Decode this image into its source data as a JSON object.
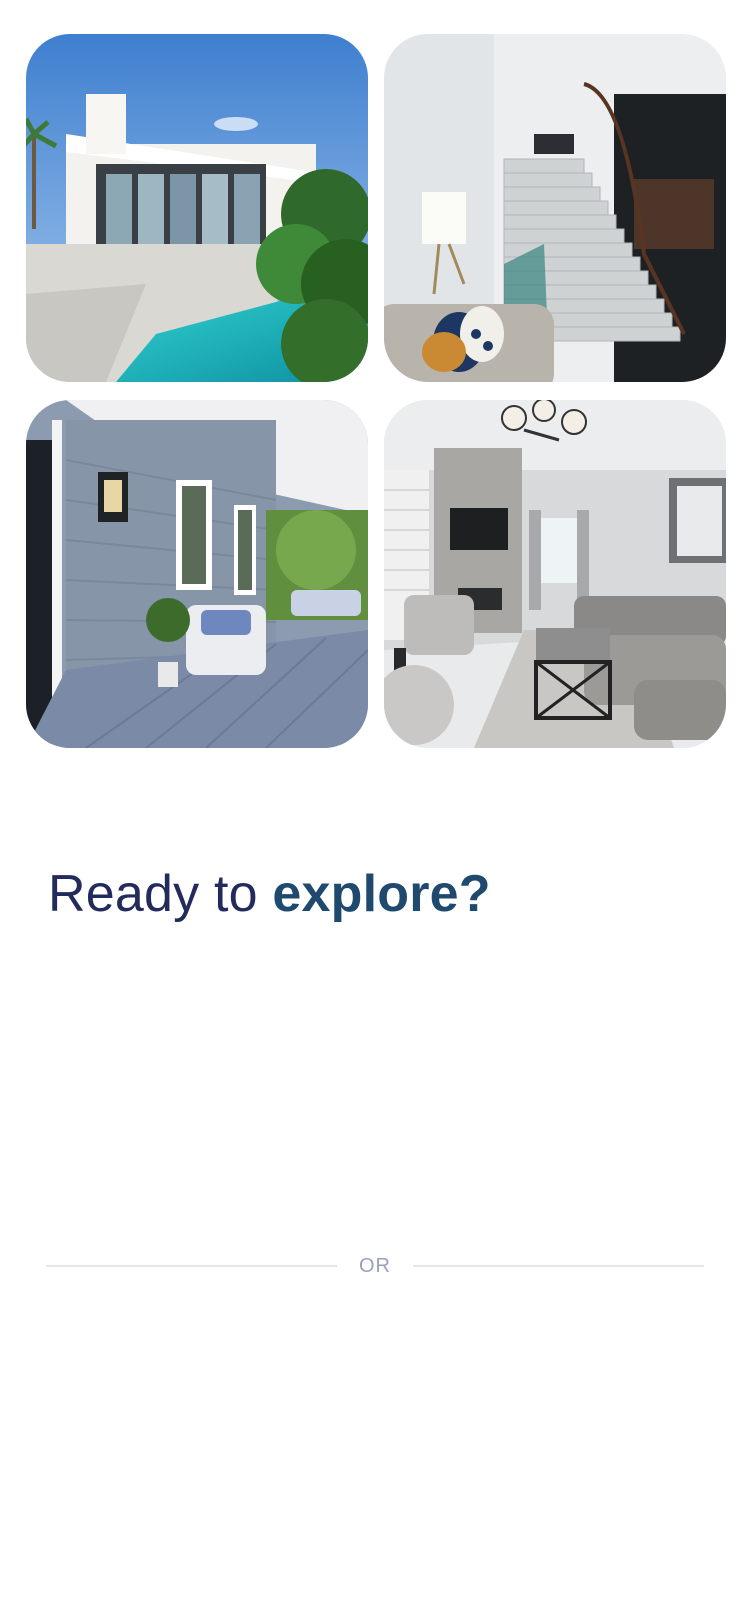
{
  "gallery": {
    "photos": [
      {
        "icon": "modern-house-pool-photo"
      },
      {
        "icon": "staircase-interior-photo"
      },
      {
        "icon": "front-porch-photo"
      },
      {
        "icon": "living-room-photo"
      }
    ]
  },
  "headline": {
    "prefix": "Ready to ",
    "accent": "explore?"
  },
  "divider": {
    "label": "OR"
  },
  "colors": {
    "headline": "#232a5c",
    "accent": "#1f4a6e",
    "divider_line": "#e6e7ee",
    "divider_text": "#9aa0ba"
  }
}
